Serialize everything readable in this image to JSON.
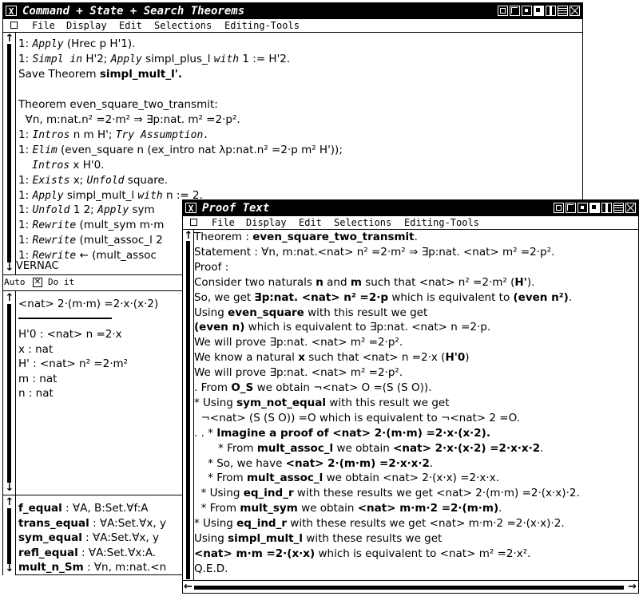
{
  "window1": {
    "title": "Command + State + Search Theorems",
    "menu": [
      "File",
      "Display",
      "Edit",
      "Selections",
      "Editing-Tools"
    ],
    "commands": [
      [
        [
          "1: ",
          ""
        ],
        [
          "Apply",
          "kw"
        ],
        [
          " (Hrec p H'1).",
          ""
        ]
      ],
      [
        [
          "1: ",
          ""
        ],
        [
          "Simpl in",
          "kw"
        ],
        [
          " H'2; ",
          ""
        ],
        [
          "Apply",
          "kw"
        ],
        [
          " simpl_plus_l ",
          ""
        ],
        [
          "with",
          "kw"
        ],
        [
          " 1 := H'2.",
          ""
        ]
      ],
      [
        [
          "Save Theorem ",
          ""
        ],
        [
          "simpl_mult_l'.",
          "b"
        ]
      ],
      [
        [
          "",
          ""
        ]
      ],
      [
        [
          "Theorem ",
          ""
        ],
        [
          "even_square_two_transmit",
          ""
        ],
        [
          ":",
          ""
        ]
      ],
      [
        [
          "  ∀n, m:nat.n² =2·m² ⇒ ∃p:nat. m² =2·p².",
          ""
        ]
      ],
      [
        [
          "1: ",
          ""
        ],
        [
          "Intros",
          "kw"
        ],
        [
          " n m H'; ",
          ""
        ],
        [
          "Try Assumption.",
          "kw"
        ]
      ],
      [
        [
          "1: ",
          ""
        ],
        [
          "Elim",
          "kw"
        ],
        [
          " (even_square n (ex_intro nat λp:nat.n² =2·p m² H'));",
          ""
        ]
      ],
      [
        [
          "    ",
          ""
        ],
        [
          "Intros",
          "kw"
        ],
        [
          " x H'0.",
          ""
        ]
      ],
      [
        [
          "1: ",
          ""
        ],
        [
          "Exists",
          "kw"
        ],
        [
          " x; ",
          ""
        ],
        [
          "Unfold",
          "kw"
        ],
        [
          " square.",
          ""
        ]
      ],
      [
        [
          "1: ",
          ""
        ],
        [
          "Apply",
          "kw"
        ],
        [
          " simpl_mult_l ",
          ""
        ],
        [
          "with",
          "kw"
        ],
        [
          " n := 2.",
          ""
        ]
      ],
      [
        [
          "1: ",
          ""
        ],
        [
          "Unfold",
          "kw"
        ],
        [
          " 1 2; ",
          ""
        ],
        [
          "Apply",
          "kw"
        ],
        [
          " sym",
          ""
        ]
      ],
      [
        [
          "1: ",
          ""
        ],
        [
          "Rewrite",
          "kw"
        ],
        [
          " (mult_sym m·m",
          ""
        ]
      ],
      [
        [
          "1: ",
          ""
        ],
        [
          "Rewrite",
          "kw"
        ],
        [
          " (mult_assoc_l 2",
          ""
        ]
      ],
      [
        [
          "1: ",
          ""
        ],
        [
          "Rewrite",
          "kw"
        ],
        [
          " ← (mult_assoc",
          ""
        ]
      ]
    ],
    "vernac_label": "VERNAC",
    "auto_label": "Auto",
    "doit_label": "Do it",
    "goal": "<nat> 2·(m·m) =2·x·(x·2)",
    "hypotheses": [
      "H'0 : <nat> n =2·x",
      "x : nat",
      "H' : <nat> n² =2·m²",
      "m : nat",
      "n : nat"
    ],
    "search": [
      [
        [
          "f_equal",
          "b"
        ],
        [
          " : ∀A, B:Set.∀f:A",
          ""
        ]
      ],
      [
        [
          "trans_equal",
          "b"
        ],
        [
          " : ∀A:Set.∀x, y",
          ""
        ]
      ],
      [
        [
          "sym_equal",
          "b"
        ],
        [
          " : ∀A:Set.∀x, y",
          ""
        ]
      ],
      [
        [
          "refl_equal",
          "b"
        ],
        [
          " : ∀A:Set.∀x:A.",
          ""
        ]
      ],
      [
        [
          "mult_n_Sm",
          "b"
        ],
        [
          " : ∀n, m:nat.<n",
          ""
        ]
      ]
    ]
  },
  "window2": {
    "title": "Proof Text",
    "menu": [
      "File",
      "Display",
      "Edit",
      "Selections",
      "Editing-Tools"
    ],
    "lines": [
      [
        [
          "Theorem : ",
          ""
        ],
        [
          "even_square_two_transmit",
          "b"
        ],
        [
          ".",
          ""
        ]
      ],
      [
        [
          "Statement : ∀n, m:nat.<nat> n² =2·m² ⇒ ∃p:nat. <nat> m² =2·p².",
          ""
        ]
      ],
      [
        [
          "Proof :",
          ""
        ]
      ],
      [
        [
          "Consider two naturals ",
          ""
        ],
        [
          "n",
          "b"
        ],
        [
          " and ",
          ""
        ],
        [
          "m",
          "b"
        ],
        [
          " such that <nat> n² =2·m² (",
          ""
        ],
        [
          "H'",
          "b"
        ],
        [
          ").",
          ""
        ]
      ],
      [
        [
          "So, we get ",
          ""
        ],
        [
          "∃p:nat. <nat> n² =2·p",
          "b"
        ],
        [
          " which is equivalent to ",
          ""
        ],
        [
          "(even n²)",
          "b"
        ],
        [
          ".",
          ""
        ]
      ],
      [
        [
          "Using ",
          ""
        ],
        [
          "even_square",
          "b"
        ],
        [
          " with this result we get",
          ""
        ]
      ],
      [
        [
          "(even n)",
          "b"
        ],
        [
          " which is equivalent to ∃p:nat. <nat> n =2·p.",
          ""
        ]
      ],
      [
        [
          "We will prove ∃p:nat. <nat> m² =2·p².",
          ""
        ]
      ],
      [
        [
          "We know a natural ",
          ""
        ],
        [
          "x",
          "b"
        ],
        [
          " such that <nat> n =2·x (",
          ""
        ],
        [
          "H'0",
          "b"
        ],
        [
          ")",
          ""
        ]
      ],
      [
        [
          "We will prove ∃p:nat. <nat> m² =2·p².",
          ""
        ]
      ],
      [
        [
          ". From ",
          ""
        ],
        [
          "O_S",
          "b"
        ],
        [
          " we obtain ¬<nat> O =(S (S O)).",
          ""
        ]
      ],
      [
        [
          "* Using ",
          ""
        ],
        [
          "sym_not_equal",
          "b"
        ],
        [
          " with this result we get",
          ""
        ]
      ],
      [
        [
          "  ¬<nat> (S (S O)) =O which is equivalent to ¬<nat> 2 =O.",
          ""
        ]
      ],
      [
        [
          ". . * ",
          ""
        ],
        [
          "Imagine a proof of <nat> 2·(m·m) =2·x·(x·2).",
          "b"
        ]
      ],
      [
        [
          "       * From ",
          ""
        ],
        [
          "mult_assoc_l",
          "b"
        ],
        [
          " we obtain ",
          ""
        ],
        [
          "<nat> 2·x·(x·2) =2·x·x·2",
          "b"
        ],
        [
          ".",
          ""
        ]
      ],
      [
        [
          "    * So, we have ",
          ""
        ],
        [
          "<nat> 2·(m·m) =2·x·x·2",
          "b"
        ],
        [
          ".",
          ""
        ]
      ],
      [
        [
          "    * From ",
          ""
        ],
        [
          "mult_assoc_l",
          "b"
        ],
        [
          " we obtain <nat> 2·(x·x) =2·x·x.",
          ""
        ]
      ],
      [
        [
          "  * Using ",
          ""
        ],
        [
          "eq_ind_r",
          "b"
        ],
        [
          " with these results we get <nat> 2·(m·m) =2·(x·x)·2.",
          ""
        ]
      ],
      [
        [
          "  * From ",
          ""
        ],
        [
          "mult_sym",
          "b"
        ],
        [
          " we obtain ",
          ""
        ],
        [
          "<nat> m·m·2 =2·(m·m)",
          "b"
        ],
        [
          ".",
          ""
        ]
      ],
      [
        [
          "* Using ",
          ""
        ],
        [
          "eq_ind_r",
          "b"
        ],
        [
          " with these results we get <nat> m·m·2 =2·(x·x)·2.",
          ""
        ]
      ],
      [
        [
          "Using ",
          ""
        ],
        [
          "simpl_mult_l",
          "b"
        ],
        [
          " with these results we get",
          ""
        ]
      ],
      [
        [
          "<nat> m·m =2·(x·x)",
          "b"
        ],
        [
          " which is equivalent to <nat> m² =2·x².",
          ""
        ]
      ],
      [
        [
          "Q.E.D.",
          ""
        ]
      ]
    ]
  }
}
